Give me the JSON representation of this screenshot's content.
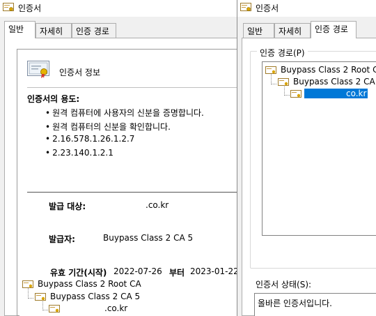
{
  "left_window": {
    "title": "인증서",
    "tabs": [
      {
        "label": "일반",
        "active": true
      },
      {
        "label": "자세히",
        "active": false
      },
      {
        "label": "인증 경로",
        "active": false
      }
    ],
    "info": {
      "title": "인증서 정보",
      "purpose_heading": "인증서의 용도:",
      "purposes": [
        "원격 컴퓨터에 사용자의 신분을 증명합니다.",
        "원격 컴퓨터의 신분을 확인합니다.",
        "2.16.578.1.26.1.2.7",
        "2.23.140.1.2.1"
      ],
      "issued_to_label": "발급 대상:",
      "issued_to_value": ".co.kr",
      "issued_by_label": "발급자:",
      "issued_by_value": "Buypass Class 2 CA 5",
      "validity_label": "유효 기간(시작)",
      "validity_from": "2022-07-26",
      "validity_to_label": "부터",
      "validity_to": "2023-01-22"
    },
    "overlay_tree": [
      {
        "label": "Buypass Class 2 Root CA"
      },
      {
        "label": "Buypass Class 2 CA 5"
      },
      {
        "label": ".co.kr"
      }
    ]
  },
  "right_window": {
    "title": "인증서",
    "tabs": [
      {
        "label": "일반",
        "active": false
      },
      {
        "label": "자세히",
        "active": false
      },
      {
        "label": "인증 경로",
        "active": true
      }
    ],
    "path_group_label": "인증 경로(P)",
    "path_tree": [
      {
        "label": "Buypass Class 2 Root CA",
        "selected": false
      },
      {
        "label": "Buypass Class 2 CA 5",
        "selected": false
      },
      {
        "label": "co.kr",
        "selected": true
      }
    ],
    "status_label": "인증서 상태(S):",
    "status_text": "올바른 인증서입니다."
  },
  "colors": {
    "window_bg": "#f0f0f0",
    "selection": "#0078d7",
    "border": "#adadad"
  },
  "icons": [
    "certificate-icon"
  ]
}
